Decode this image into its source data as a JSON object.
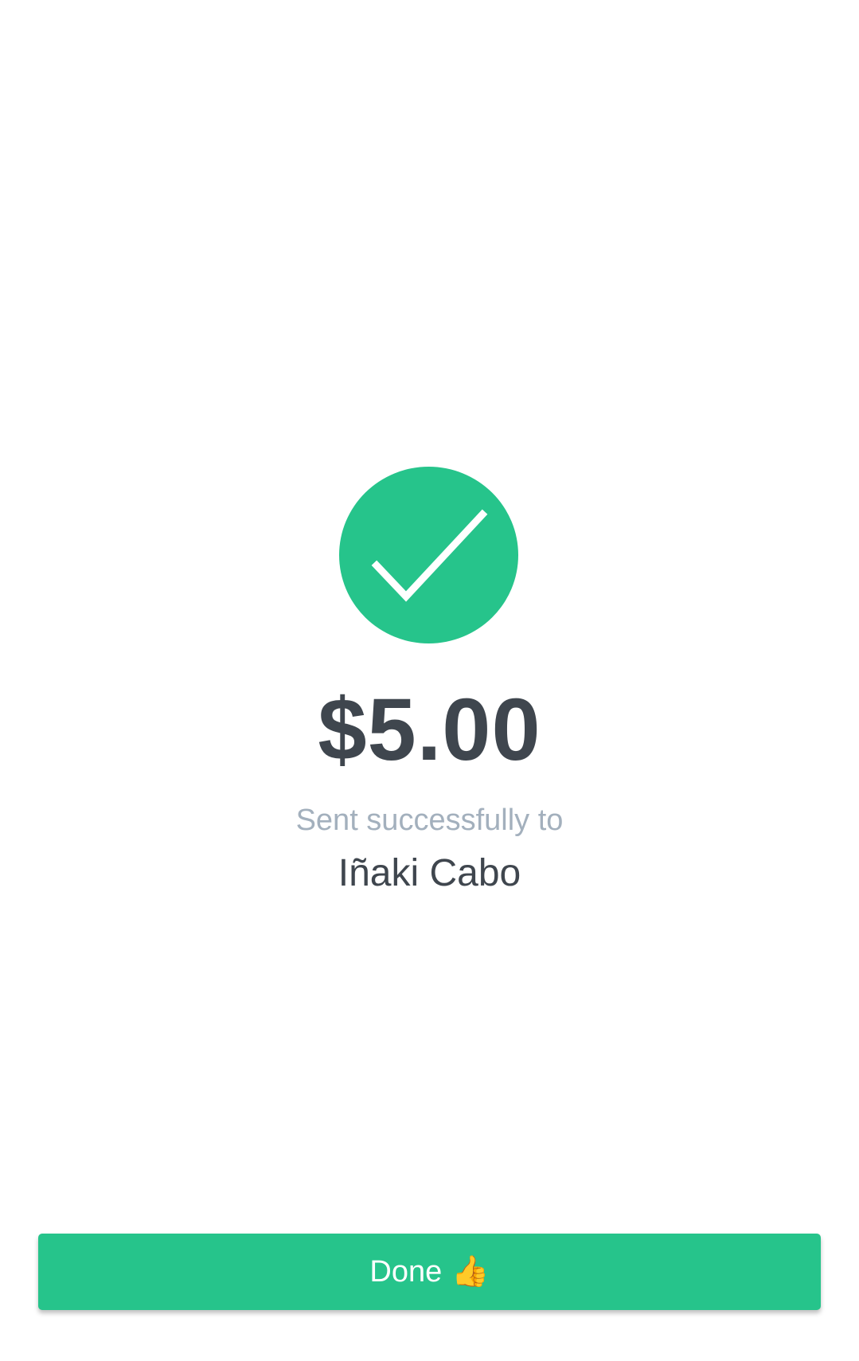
{
  "success": {
    "icon": "checkmark-circle-icon",
    "color": "#26c48b"
  },
  "amount": "$5.00",
  "subtitle": "Sent successfully to",
  "recipient": "Iñaki Cabo",
  "done_button": {
    "label": "Done",
    "icon": "thumbs-up-icon",
    "glyph": "👍",
    "color": "#26c48b"
  }
}
